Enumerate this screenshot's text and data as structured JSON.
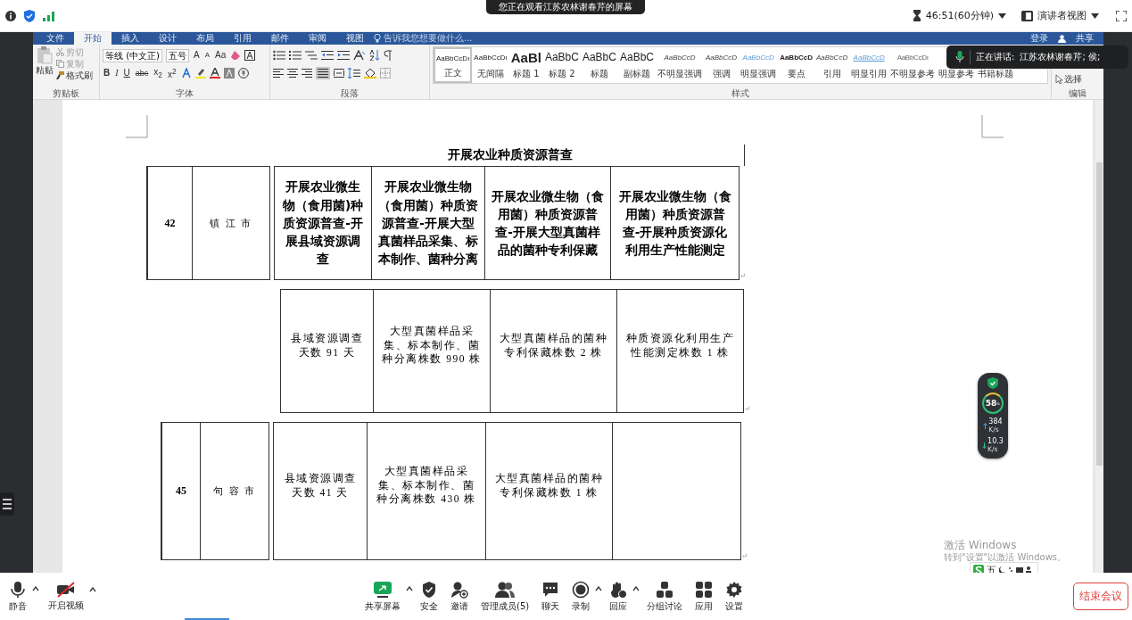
{
  "viewer_bar": {
    "sharing_banner": "您正在观看江苏农林谢春芹的屏幕",
    "timer": "46:51(60分钟)",
    "view_button": "演讲者视图"
  },
  "word": {
    "tabs": [
      {
        "label": "文件",
        "selected": false
      },
      {
        "label": "开始",
        "selected": true
      },
      {
        "label": "插入",
        "selected": false
      },
      {
        "label": "设计",
        "selected": false
      },
      {
        "label": "布局",
        "selected": false
      },
      {
        "label": "引用",
        "selected": false
      },
      {
        "label": "邮件",
        "selected": false
      },
      {
        "label": "审阅",
        "selected": false
      },
      {
        "label": "视图",
        "selected": false
      }
    ],
    "tell_me": "告诉我您想要做什么...",
    "sign_in": "登录",
    "share": "共享",
    "clipboard": {
      "paste": "粘贴",
      "items": [
        {
          "label": "剪切",
          "kind": "cut",
          "disabled": true
        },
        {
          "label": "复制",
          "kind": "copy",
          "disabled": true
        },
        {
          "label": "格式刷",
          "kind": "brush",
          "disabled": false
        }
      ],
      "label": "剪贴板"
    },
    "font": {
      "name": "等线 (中文正)",
      "size": "五号",
      "case_button": "Aa",
      "grow": "A",
      "shrink": "A",
      "format_buttons": [
        "B",
        "I",
        "U",
        "abc",
        "x$_{2}$",
        "x$^{2}$"
      ],
      "label": "字体"
    },
    "paragraph": {
      "label": "段落"
    },
    "styles": {
      "items": [
        {
          "preview": "AaBbCcDı",
          "name": "正文",
          "kind": "normal",
          "selected": true
        },
        {
          "preview": "AaBbCcDı",
          "name": "无间隔",
          "kind": "normal",
          "selected": false
        },
        {
          "preview": "AaBl",
          "name": "标题 1",
          "kind": "heading",
          "selected": false
        },
        {
          "preview": "AaBbC",
          "name": "标题 2",
          "kind": "subheading",
          "selected": false
        },
        {
          "preview": "AaBbC",
          "name": "标题",
          "kind": "subheading",
          "selected": false
        },
        {
          "preview": "AaBbC",
          "name": "副标题",
          "kind": "subheading",
          "selected": false
        },
        {
          "preview": "AaBbCcD",
          "name": "不明显强调",
          "kind": "italic",
          "selected": false
        },
        {
          "preview": "AaBbCcD",
          "name": "强调",
          "kind": "italic",
          "selected": false
        },
        {
          "preview": "AaBbCcD",
          "name": "明显强调",
          "kind": "accent",
          "selected": false
        },
        {
          "preview": "AaBbCcD",
          "name": "要点",
          "kind": "bold",
          "selected": false
        },
        {
          "preview": "AaBbCcD",
          "name": "引用",
          "kind": "italic",
          "selected": false
        },
        {
          "preview": "AaBbCcD",
          "name": "明显引用",
          "kind": "underline",
          "selected": false
        },
        {
          "preview": "AaBbCcDı",
          "name": "不明显参考",
          "kind": "caps",
          "selected": false
        },
        {
          "name": "明显参考",
          "selected": false
        },
        {
          "name": "书籍标题",
          "selected": false
        }
      ],
      "label": "样式"
    },
    "editing": {
      "select": "选择",
      "label": "编辑"
    }
  },
  "speaking": {
    "label": "正在讲话:",
    "names": "江苏农林谢春芹; 侯;"
  },
  "document": {
    "table_title": "开展农业种质资源普查",
    "end_mark": "↵",
    "blocks": [
      {
        "kind": "header",
        "number": "42",
        "city": "镇 江 市",
        "cells": [
          "开展农业微生物（食用菌)种质资源普查-开展县域资源调查",
          "开展农业微生物（食用菌）种质资源普查-开展大型真菌样品采集、标本制作、菌种分离",
          "开展农业微生物（食用菌）种质资源普查-开展大型真菌样品的菌种专利保藏",
          "开展农业微生物（食用菌）种质资源普查-开展种质资源化利用生产性能测定"
        ]
      },
      {
        "kind": "values",
        "cells": [
          "县域资源调查天数 91 天",
          "大型真菌样品采集、标本制作、菌种分离株数 990 株",
          "大型真菌样品的菌种专利保藏株数 2 株",
          "种质资源化利用生产性能测定株数 1 株"
        ]
      },
      {
        "kind": "city",
        "number": "45",
        "city": "句 容 市",
        "cells": [
          "县域资源调查天数 41 天",
          "大型真菌样品采集、标本制作、菌种分离株数 430 株",
          "大型真菌样品的菌种专利保藏株数 1 株"
        ]
      }
    ]
  },
  "net_monitor": {
    "percent": "58",
    "unit": "%",
    "upload": "384",
    "upload_unit": "K/s",
    "download": "10.3",
    "download_unit": "K/s"
  },
  "activation_notice": {
    "title": "激活 Windows",
    "hint": "转到\"设置\"以激活 Windows。"
  },
  "ime_bar": {
    "mode": "五"
  },
  "toolbar": {
    "left": [
      {
        "label": "静音",
        "kind": "mic",
        "menu": true
      },
      {
        "label": "开启视频",
        "kind": "video-off",
        "menu": true
      }
    ],
    "center": [
      {
        "label": "共享屏幕",
        "kind": "share",
        "menu": true
      },
      {
        "label": "安全",
        "kind": "shield",
        "menu": false
      },
      {
        "label": "邀请",
        "kind": "invite",
        "menu": false
      },
      {
        "label": "管理成员(5)",
        "kind": "people",
        "menu": false
      },
      {
        "label": "聊天",
        "kind": "chat",
        "menu": false
      },
      {
        "label": "录制",
        "kind": "record",
        "menu": true
      },
      {
        "label": "回应",
        "kind": "react",
        "menu": true
      },
      {
        "label": "分组讨论",
        "kind": "rooms",
        "menu": false
      },
      {
        "label": "应用",
        "kind": "apps",
        "menu": false
      },
      {
        "label": "设置",
        "kind": "gear",
        "menu": false
      }
    ],
    "end_button": "结束会议"
  }
}
